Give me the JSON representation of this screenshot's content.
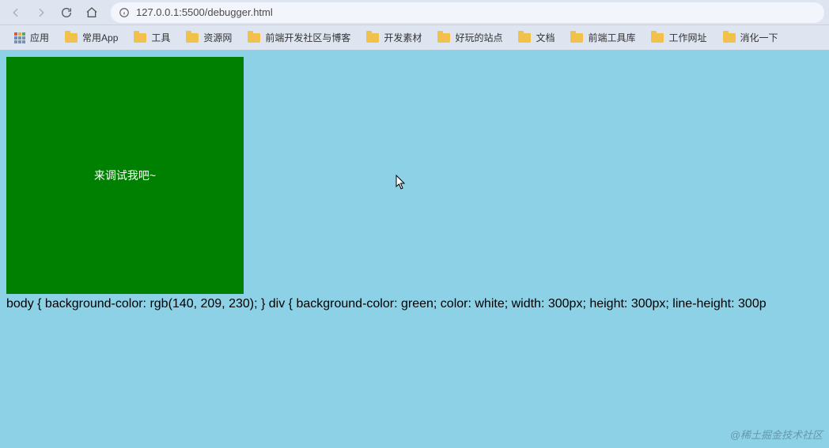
{
  "toolbar": {
    "url": "127.0.0.1:5500/debugger.html"
  },
  "bookmarks": {
    "apps_label": "应用",
    "items": [
      {
        "label": "常用App"
      },
      {
        "label": "工具"
      },
      {
        "label": "资源网"
      },
      {
        "label": "前端开发社区与博客"
      },
      {
        "label": "开发素材"
      },
      {
        "label": "好玩的站点"
      },
      {
        "label": "文档"
      },
      {
        "label": "前端工具库"
      },
      {
        "label": "工作网址"
      },
      {
        "label": "消化一下"
      }
    ]
  },
  "page": {
    "green_box_text": "来调试我吧~",
    "css_text": "body { background-color: rgb(140, 209, 230); } div { background-color: green; color: white; width: 300px; height: 300px; line-height: 300p",
    "watermark": "@稀土掘金技术社区"
  }
}
